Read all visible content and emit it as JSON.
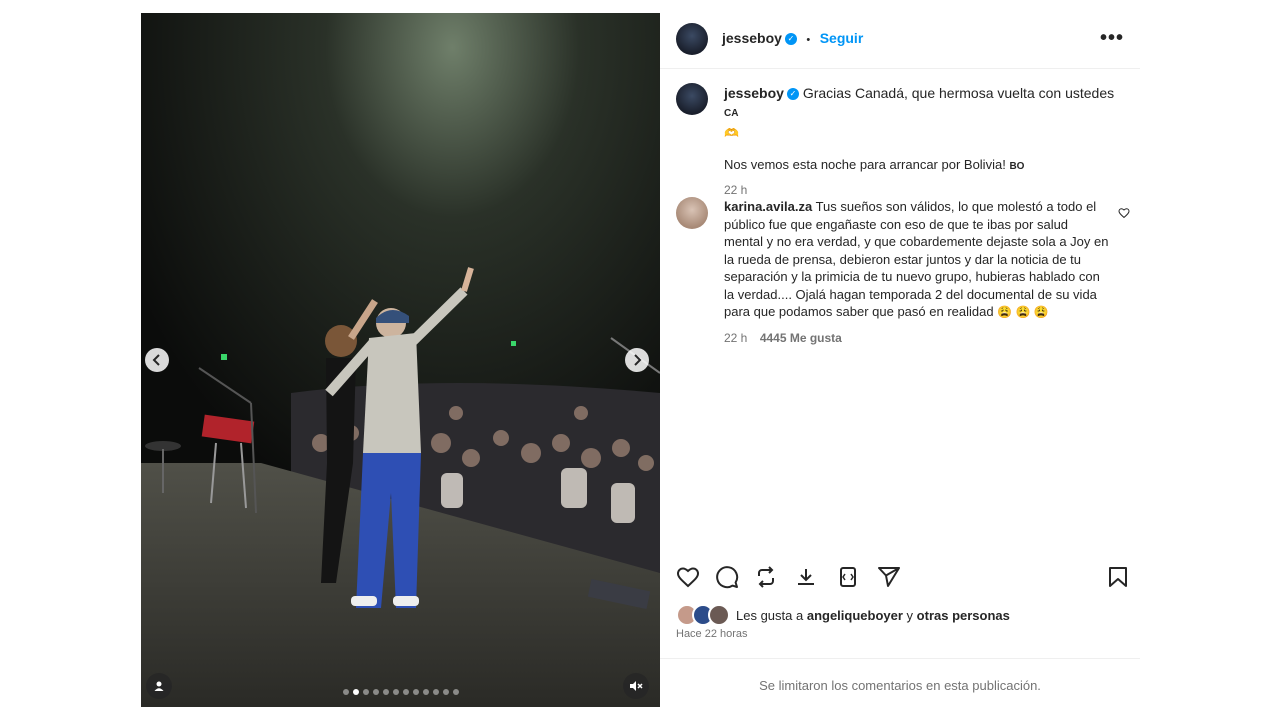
{
  "media": {
    "carousel_total": 12,
    "carousel_active": 1,
    "icons": {
      "prev": "chevron-left-icon",
      "next": "chevron-right-icon",
      "tag": "user-tag-icon",
      "mute": "speaker-muted-icon"
    }
  },
  "header": {
    "username": "jesseboy",
    "separator": "•",
    "follow_label": "Seguir",
    "more_label": "•••"
  },
  "caption": {
    "username": "jesseboy",
    "line1": "Gracias Canadá, que hermosa vuelta con ustedes",
    "flag1": "CA",
    "emoji1": "🫶",
    "line2": "Nos vemos esta noche para arrancar por Bolivia!",
    "flag2": "BO",
    "time": "22 h"
  },
  "comment": {
    "username": "karina.avila.za",
    "text": "Tus sueños son válidos, lo que molestó a todo el público fue que engañaste con eso de que te ibas por salud mental y no era verdad, y que cobardemente dejaste sola a Joy en la rueda de prensa, debieron estar juntos y dar la noticia de tu separación y la primicia de tu nuevo grupo, hubieras hablado con la verdad.... Ojalá hagan temporada 2 del documental de su vida para que podamos saber que pasó en realidad",
    "emojis": "😩 😩 😩",
    "time": "22 h",
    "likes": "4445 Me gusta"
  },
  "actions": {
    "icons": [
      "heart-icon",
      "comment-icon",
      "repost-icon",
      "download-icon",
      "embed-icon",
      "share-icon",
      "save-icon"
    ]
  },
  "likes": {
    "prefix": "Les gusta a",
    "user": "angeliqueboyer",
    "conj": "y",
    "others": "otras personas"
  },
  "posted": "Hace 22 horas",
  "comments_limited": "Se limitaron los comentarios en esta publicación.",
  "colors": {
    "link": "#0095f6",
    "secondary": "#737373",
    "verified": "#0095f6"
  }
}
